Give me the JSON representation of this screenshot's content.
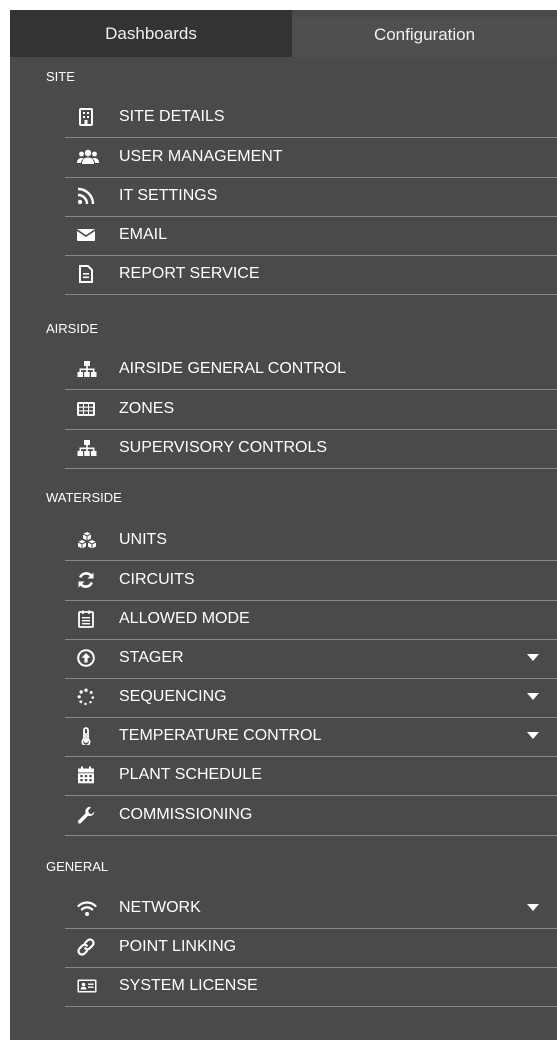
{
  "tabs": [
    {
      "label": "Dashboards",
      "active": false
    },
    {
      "label": "Configuration",
      "active": true
    }
  ],
  "sections": [
    {
      "title": "SITE",
      "items": [
        {
          "label": "SITE DETAILS",
          "icon": "building-icon"
        },
        {
          "label": "USER MANAGEMENT",
          "icon": "users-icon"
        },
        {
          "label": "IT SETTINGS",
          "icon": "rss-icon"
        },
        {
          "label": "EMAIL",
          "icon": "envelope-icon"
        },
        {
          "label": "REPORT SERVICE",
          "icon": "file-icon"
        }
      ]
    },
    {
      "title": "AIRSIDE",
      "items": [
        {
          "label": "AIRSIDE GENERAL CONTROL",
          "icon": "sitemap-icon"
        },
        {
          "label": "ZONES",
          "icon": "grid-icon"
        },
        {
          "label": "SUPERVISORY CONTROLS",
          "icon": "sitemap-icon"
        }
      ]
    },
    {
      "title": "WATERSIDE",
      "items": [
        {
          "label": "UNITS",
          "icon": "cubes-icon"
        },
        {
          "label": "CIRCUITS",
          "icon": "refresh-icon"
        },
        {
          "label": "ALLOWED MODE",
          "icon": "calendar-list-icon"
        },
        {
          "label": "STAGER",
          "icon": "arrow-circle-up-icon",
          "expandable": true
        },
        {
          "label": "SEQUENCING",
          "icon": "spinner-icon",
          "expandable": true
        },
        {
          "label": "TEMPERATURE CONTROL",
          "icon": "thermometer-icon",
          "expandable": true
        },
        {
          "label": "PLANT SCHEDULE",
          "icon": "calendar-icon"
        },
        {
          "label": "COMMISSIONING",
          "icon": "wrench-icon"
        }
      ]
    },
    {
      "title": "GENERAL",
      "items": [
        {
          "label": "NETWORK",
          "icon": "wifi-icon",
          "expandable": true
        },
        {
          "label": "POINT LINKING",
          "icon": "link-icon"
        },
        {
          "label": "SYSTEM LICENSE",
          "icon": "id-card-icon"
        }
      ]
    }
  ],
  "colors": {
    "panel": "#4a4a4a",
    "tab_inactive": "#333333",
    "tab_active": "#4f4f4f",
    "divider": "#8a8a8a",
    "text": "#ffffff"
  }
}
